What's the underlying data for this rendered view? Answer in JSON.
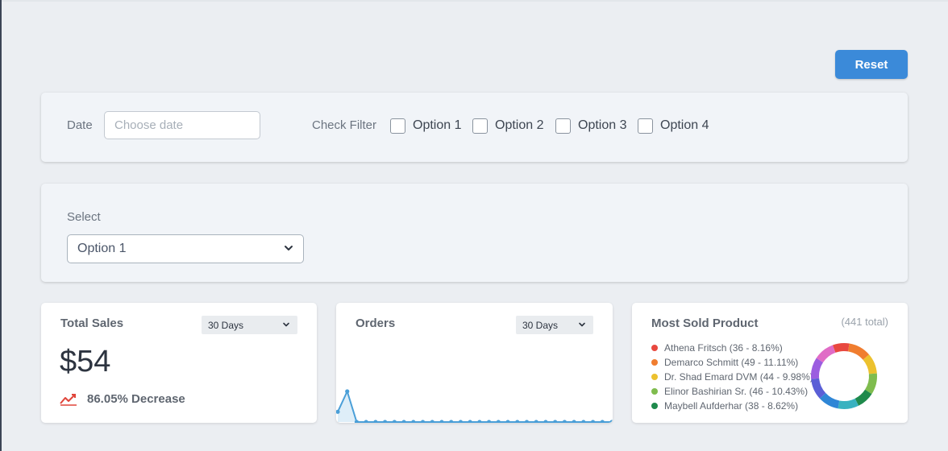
{
  "toolbar": {
    "reset_label": "Reset"
  },
  "filters": {
    "date_label": "Date",
    "date_placeholder": "Choose date",
    "check_label": "Check Filter",
    "options": [
      "Option 1",
      "Option 2",
      "Option 3",
      "Option 4"
    ]
  },
  "select": {
    "label": "Select",
    "value": "Option 1"
  },
  "total_sales": {
    "title": "Total Sales",
    "period": "30 Days",
    "value": "$54",
    "change": "86.05% Decrease",
    "trend_color": "#e0453a"
  },
  "orders": {
    "title": "Orders",
    "period": "30 Days"
  },
  "most_sold": {
    "title": "Most Sold Product",
    "total": "(441 total)",
    "items": [
      {
        "label": "Athena Fritsch (36 - 8.16%)",
        "color": "#e8483f"
      },
      {
        "label": "Demarco Schmitt (49 - 11.11%)",
        "color": "#f07d2f"
      },
      {
        "label": "Dr. Shad Emard DVM (44 - 9.98%)",
        "color": "#ecc12e"
      },
      {
        "label": "Elinor Bashirian Sr. (46 - 10.43%)",
        "color": "#7fbc4e"
      },
      {
        "label": "Maybell Aufderhar (38 - 8.62%)",
        "color": "#1f8a4c"
      }
    ]
  },
  "chart_data": [
    {
      "type": "area",
      "title": "Orders",
      "x": [
        1,
        2,
        3,
        4,
        5,
        6,
        7,
        8,
        9,
        10,
        11,
        12,
        13,
        14,
        15,
        16,
        17,
        18,
        19,
        20,
        21,
        22,
        23,
        24,
        25,
        26,
        27,
        28,
        29,
        30
      ],
      "values": [
        1,
        3,
        0,
        0,
        0,
        0,
        0,
        0,
        0,
        0,
        0,
        0,
        0,
        0,
        0,
        0,
        0,
        0,
        0,
        0,
        0,
        0,
        0,
        0,
        0,
        0,
        0,
        0,
        0,
        0
      ],
      "color": "#4a9fd8"
    },
    {
      "type": "pie",
      "title": "Most Sold Product",
      "slices": [
        {
          "label": "Athena Fritsch",
          "value": 36,
          "color": "#e8483f"
        },
        {
          "label": "Demarco Schmitt",
          "value": 49,
          "color": "#f07d2f"
        },
        {
          "label": "Dr. Shad Emard DVM",
          "value": 44,
          "color": "#ecc12e"
        },
        {
          "label": "Elinor Bashirian Sr.",
          "value": 46,
          "color": "#7fbc4e"
        },
        {
          "label": "Maybell Aufderhar",
          "value": 38,
          "color": "#1f8a4c"
        },
        {
          "value": 45,
          "color": "#38b2c0"
        },
        {
          "value": 45,
          "color": "#2f86d6"
        },
        {
          "value": 46,
          "color": "#5a5fd6"
        },
        {
          "value": 47,
          "color": "#9b5de0"
        },
        {
          "value": 45,
          "color": "#e06cc6"
        }
      ]
    }
  ]
}
